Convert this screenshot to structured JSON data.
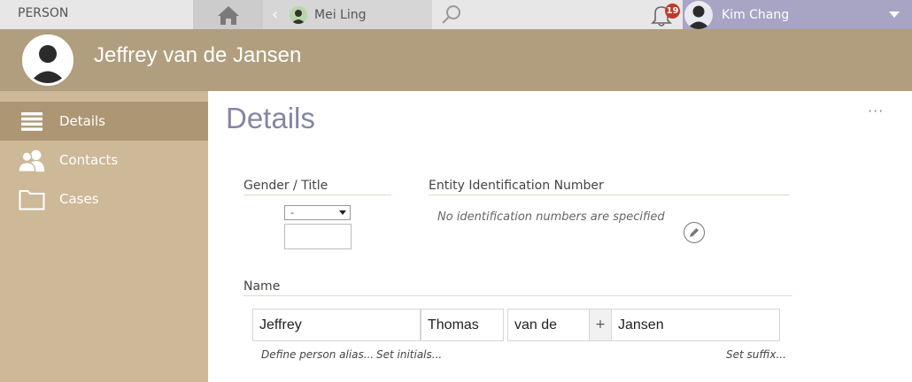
{
  "topbar": {
    "entity_label": "PERSON",
    "home_icon": "home-icon",
    "tab_back_icon": "chevron-left-icon",
    "tab_label": "Mei Ling",
    "search_icon": "search-icon",
    "notifications_icon": "bell-icon",
    "notification_count": "19",
    "user_name": "Kim Chang",
    "user_menu_icon": "chevron-down-icon"
  },
  "header": {
    "title": "Jeffrey van de Jansen"
  },
  "sidebar": {
    "items": [
      {
        "label": "Details",
        "icon": "list-icon",
        "active": true
      },
      {
        "label": "Contacts",
        "icon": "contacts-icon",
        "active": false
      },
      {
        "label": "Cases",
        "icon": "folder-icon",
        "active": false
      }
    ]
  },
  "main": {
    "title": "Details",
    "more_label": "···",
    "gender": {
      "label": "Gender / Title",
      "selected": "-",
      "title_value": ""
    },
    "identification": {
      "label": "Entity Identification Number",
      "empty_text": "No identification numbers are specified"
    },
    "name": {
      "label": "Name",
      "first": "Jeffrey",
      "middle": "Thomas",
      "prefix": "van de",
      "plus": "+",
      "last": "Jansen",
      "define_alias": "Define person alias...",
      "set_initials": "Set initials...",
      "set_suffix": "Set suffix..."
    }
  },
  "colors": {
    "header_bg": "#b09e7e",
    "sidebar_bg": "#cdb898",
    "sidebar_active": "#ad9673",
    "user_bar": "#a8a4c4",
    "title_color": "#8585a5",
    "badge": "#c0392b"
  }
}
